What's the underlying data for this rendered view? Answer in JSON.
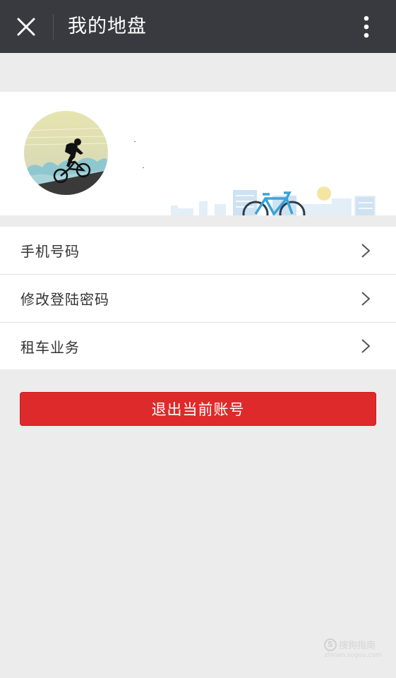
{
  "header": {
    "title": "我的地盘",
    "close_icon": "close-icon",
    "more_icon": "more-vertical-icon"
  },
  "profile": {
    "avatar": "cyclist-avatar"
  },
  "menu": {
    "items": [
      {
        "label": "手机号码",
        "icon": "chevron-right-icon"
      },
      {
        "label": "修改登陆密码",
        "icon": "chevron-right-icon"
      },
      {
        "label": "租车业务",
        "icon": "chevron-right-icon"
      }
    ]
  },
  "logout": {
    "label": "退出当前账号"
  },
  "watermark": {
    "text": "搜狗指南",
    "sub": "zhinan.sogou.com",
    "badge": "S"
  },
  "colors": {
    "topbar": "#393a3f",
    "logout": "#de2a2a",
    "background": "#ececec"
  }
}
